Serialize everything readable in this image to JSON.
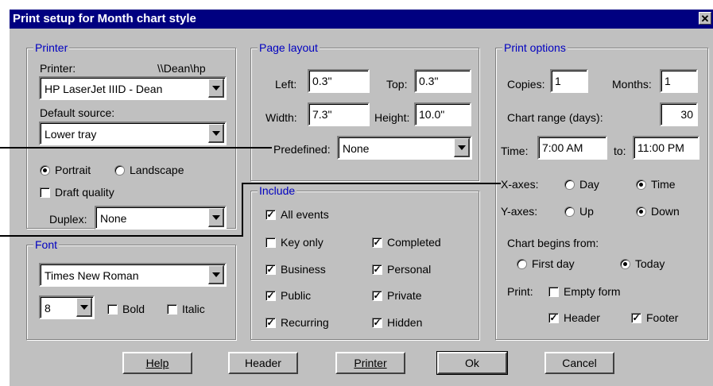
{
  "title": "Print setup for Month chart style",
  "close_glyph": "✕",
  "printer_group": {
    "title": "Printer",
    "printer_label": "Printer:",
    "printer_path": "\\\\Dean\\hp",
    "printer_value": "HP LaserJet IIID - Dean",
    "source_label": "Default source:",
    "source_value": "Lower tray",
    "portrait_label": "Portrait",
    "landscape_label": "Landscape",
    "orientation": "portrait",
    "draft_label": "Draft quality",
    "draft_checked": false,
    "duplex_label": "Duplex:",
    "duplex_value": "None"
  },
  "font_group": {
    "title": "Font",
    "font_value": "Times New Roman",
    "size_value": "8",
    "bold_label": "Bold",
    "bold_checked": false,
    "italic_label": "Italic",
    "italic_checked": false
  },
  "page_layout": {
    "title": "Page layout",
    "left_label": "Left:",
    "left_value": "0.3\"",
    "top_label": "Top:",
    "top_value": "0.3\"",
    "width_label": "Width:",
    "width_value": "7.3\"",
    "height_label": "Height:",
    "height_value": "10.0\"",
    "predefined_label": "Predefined:",
    "predefined_value": "None"
  },
  "include": {
    "title": "Include",
    "all_events": {
      "label": "All events",
      "checked": true
    },
    "key_only": {
      "label": "Key only",
      "checked": false
    },
    "completed": {
      "label": "Completed",
      "checked": true
    },
    "business": {
      "label": "Business",
      "checked": true
    },
    "personal": {
      "label": "Personal",
      "checked": true
    },
    "public": {
      "label": "Public",
      "checked": true
    },
    "private": {
      "label": "Private",
      "checked": true
    },
    "recurring": {
      "label": "Recurring",
      "checked": true
    },
    "hidden": {
      "label": "Hidden",
      "checked": true
    }
  },
  "print_options": {
    "title": "Print options",
    "copies_label": "Copies:",
    "copies_value": "1",
    "months_label": "Months:",
    "months_value": "1",
    "range_label": "Chart range (days):",
    "range_value": "30",
    "time_label": "Time:",
    "time_from": "7:00 AM",
    "to_label": "to:",
    "time_to": "11:00 PM",
    "xaxes_label": "X-axes:",
    "xaxes_day": "Day",
    "xaxes_time": "Time",
    "xaxes_selected": "time",
    "yaxes_label": "Y-axes:",
    "yaxes_up": "Up",
    "yaxes_down": "Down",
    "yaxes_selected": "down",
    "begins_label": "Chart begins from:",
    "first_day_label": "First day",
    "today_label": "Today",
    "begins_selected": "today",
    "print_label": "Print:",
    "empty_form": {
      "label": "Empty form",
      "checked": false
    },
    "header": {
      "label": "Header",
      "checked": true
    },
    "footer": {
      "label": "Footer",
      "checked": true
    }
  },
  "buttons": {
    "help": "Help",
    "header": "Header",
    "printer": "Printer",
    "ok": "Ok",
    "cancel": "Cancel"
  },
  "colors": {
    "face": "#c0c0c0",
    "titlebar": "#000080",
    "group_title": "#0000c0"
  }
}
